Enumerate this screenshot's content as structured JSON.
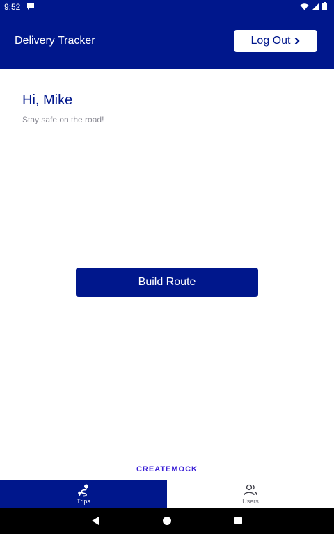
{
  "status_bar": {
    "time": "9:52",
    "icons": [
      "message-notification-icon",
      "wifi-icon",
      "signal-icon",
      "battery-icon"
    ]
  },
  "app_bar": {
    "title": "Delivery Tracker",
    "logout_label": "Log Out",
    "logout_icon": "chevron-right-icon"
  },
  "main": {
    "greeting": "Hi, Mike",
    "subtitle": "Stay safe on the road!",
    "build_route_label": "Build Route"
  },
  "footer": {
    "link_text": "CREATEMOCK"
  },
  "tab_bar": {
    "tabs": [
      {
        "label": "Trips",
        "icon": "route-icon",
        "active": true
      },
      {
        "label": "Users",
        "icon": "users-icon",
        "active": false
      }
    ]
  },
  "nav_bar": {
    "buttons": [
      "back-icon",
      "home-icon",
      "recents-icon"
    ]
  },
  "colors": {
    "primary": "#00178c",
    "background": "#ffffff",
    "subtitle_text": "#8a8a94",
    "footer_link": "#3a1fd6"
  }
}
